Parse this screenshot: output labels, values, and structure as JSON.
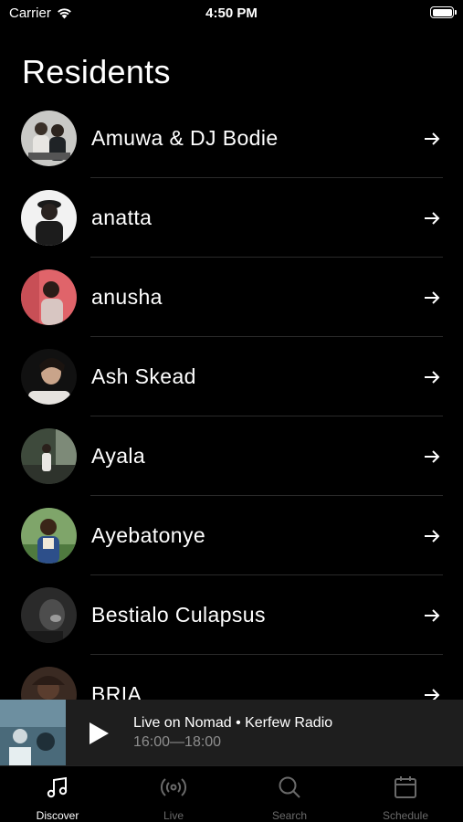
{
  "status": {
    "carrier": "Carrier",
    "time": "4:50 PM"
  },
  "page": {
    "title": "Residents"
  },
  "residents": [
    {
      "name": "Amuwa & DJ Bodie"
    },
    {
      "name": "anatta"
    },
    {
      "name": "anusha"
    },
    {
      "name": "Ash Skead"
    },
    {
      "name": "Ayala"
    },
    {
      "name": "Ayebatonye"
    },
    {
      "name": "Bestialo Culapsus"
    },
    {
      "name": "BRIA"
    }
  ],
  "player": {
    "title": "Live on Nomad • Kerfew Radio",
    "time": "16:00—18:00"
  },
  "tabs": [
    {
      "label": "Discover",
      "icon": "music-note-icon",
      "active": true
    },
    {
      "label": "Live",
      "icon": "broadcast-icon",
      "active": false
    },
    {
      "label": "Search",
      "icon": "search-icon",
      "active": false
    },
    {
      "label": "Schedule",
      "icon": "calendar-icon",
      "active": false
    }
  ],
  "colors": {
    "background": "#000000",
    "player_bg": "#1e1e1e",
    "inactive": "#6a6a6a",
    "divider": "#2a2a2a"
  }
}
